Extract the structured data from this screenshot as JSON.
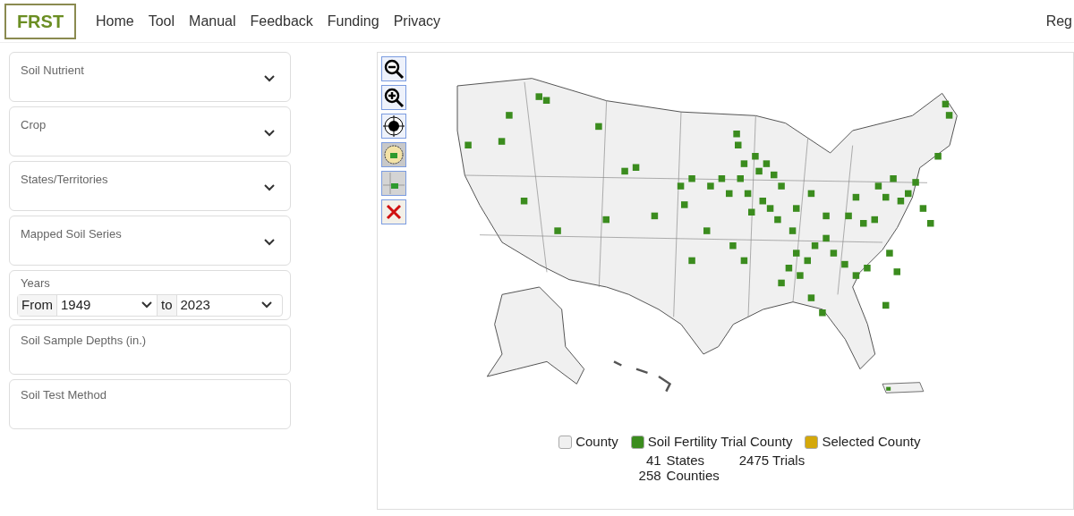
{
  "logo": {
    "text": "FRST"
  },
  "nav": [
    {
      "label": "Home"
    },
    {
      "label": "Tool"
    },
    {
      "label": "Manual"
    },
    {
      "label": "Feedback"
    },
    {
      "label": "Funding"
    },
    {
      "label": "Privacy"
    }
  ],
  "nav_right": "Reg",
  "filters": [
    {
      "kind": "select",
      "label": "Soil Nutrient"
    },
    {
      "kind": "select",
      "label": "Crop"
    },
    {
      "kind": "select",
      "label": "States/Territories"
    },
    {
      "kind": "select",
      "label": "Mapped Soil Series"
    },
    {
      "kind": "years",
      "label": "Years",
      "from_label": "From",
      "from_value": "1949",
      "to_label": "to",
      "to_value": "2023"
    },
    {
      "kind": "text",
      "label": "Soil Sample Depths (in.)"
    },
    {
      "kind": "text",
      "label": "Soil Test Method"
    }
  ],
  "map_tools": [
    {
      "kind": "zoom-out"
    },
    {
      "kind": "zoom-in"
    },
    {
      "kind": "center"
    },
    {
      "kind": "select-circle"
    },
    {
      "kind": "select-box"
    },
    {
      "kind": "clear"
    }
  ],
  "legend": [
    {
      "label": "County",
      "color": "#f0f0f0"
    },
    {
      "label": "Soil Fertility Trial County",
      "color": "#3b8c1e"
    },
    {
      "label": "Selected County",
      "color": "#d4a80a"
    }
  ],
  "stats": {
    "states_count": "41",
    "states_label": "States",
    "counties_count": "258",
    "counties_label": "Counties",
    "trials": "2475 Trials"
  }
}
